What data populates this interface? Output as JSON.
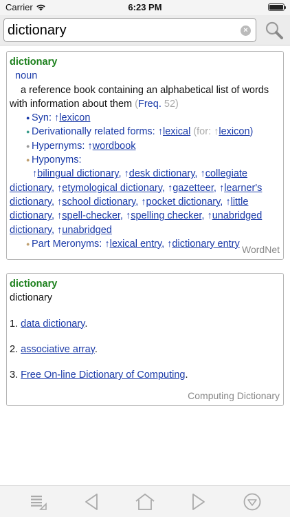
{
  "status": {
    "carrier": "Carrier",
    "time": "6:23 PM",
    "battery_level": 1.0
  },
  "search": {
    "value": "dictionary"
  },
  "wordnet": {
    "headword": "dictionary",
    "pos": "noun",
    "definition": "a reference book containing an alphabetical list of words with information about them",
    "freq_label": "Freq.",
    "freq_value": "52",
    "syn_label": "Syn:",
    "syn_link": "lexicon",
    "deriv_label": "Derivationally related forms:",
    "deriv_link": "lexical",
    "deriv_for_label": "(for:",
    "deriv_for_link": "lexicon",
    "hypernyms_label": "Hypernyms:",
    "hypernyms_link": "wordbook",
    "hyponyms_label": "Hyponyms:",
    "hyponyms": [
      "bilingual dictionary",
      "desk dictionary",
      "collegiate dictionary",
      "etymological dictionary",
      "gazetteer",
      "learner's dictionary",
      "school dictionary",
      "pocket dictionary",
      "little dictionary",
      "spell-checker",
      "spelling checker",
      "unabridged dictionary",
      "unabridged"
    ],
    "meronyms_label": "Part Meronyms:",
    "meronyms": [
      "lexical entry",
      "dictionary entry"
    ],
    "source": "WordNet"
  },
  "computing": {
    "headword": "dictionary",
    "subtitle": "dictionary",
    "items": [
      {
        "num": "1.",
        "link": "data dictionary"
      },
      {
        "num": "2.",
        "link": "associative array"
      },
      {
        "num": "3.",
        "link": "Free On-line Dictionary of Computing"
      }
    ],
    "source": "Computing Dictionary"
  },
  "toolbar": {
    "icons": [
      "list-icon",
      "back-icon",
      "home-icon",
      "forward-icon",
      "menu-icon"
    ]
  }
}
